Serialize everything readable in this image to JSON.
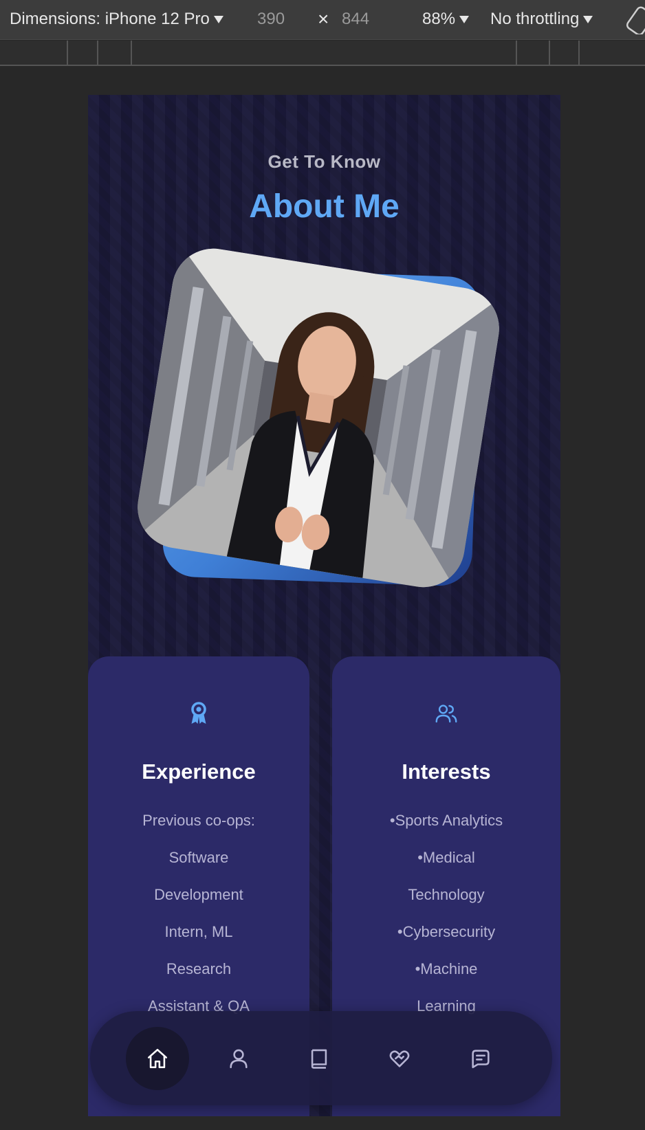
{
  "devtools": {
    "device_label": "Dimensions: iPhone 12 Pro",
    "width_value": "390",
    "times": "×",
    "height_value": "844",
    "zoom_label": "88%",
    "throttling_label": "No throttling"
  },
  "about": {
    "subtitle": "Get To Know",
    "title": "About Me",
    "accent_color": "#5fa8f5"
  },
  "cards": {
    "experience": {
      "icon": "award-icon",
      "title": "Experience",
      "lines": [
        "Previous co-ops:",
        "Software",
        "Development",
        "Intern, ML",
        "Research",
        "Assistant & QA"
      ]
    },
    "interests": {
      "icon": "users-icon",
      "title": "Interests",
      "lines": [
        "•Sports Analytics",
        "•Medical",
        "Technology",
        "•Cybersecurity",
        "•Machine",
        "Learning"
      ]
    }
  },
  "nav": {
    "items": [
      {
        "icon": "home-icon",
        "active": true
      },
      {
        "icon": "user-icon",
        "active": false
      },
      {
        "icon": "book-icon",
        "active": false
      },
      {
        "icon": "heart-handshake-icon",
        "active": false
      },
      {
        "icon": "message-square-icon",
        "active": false
      }
    ]
  }
}
